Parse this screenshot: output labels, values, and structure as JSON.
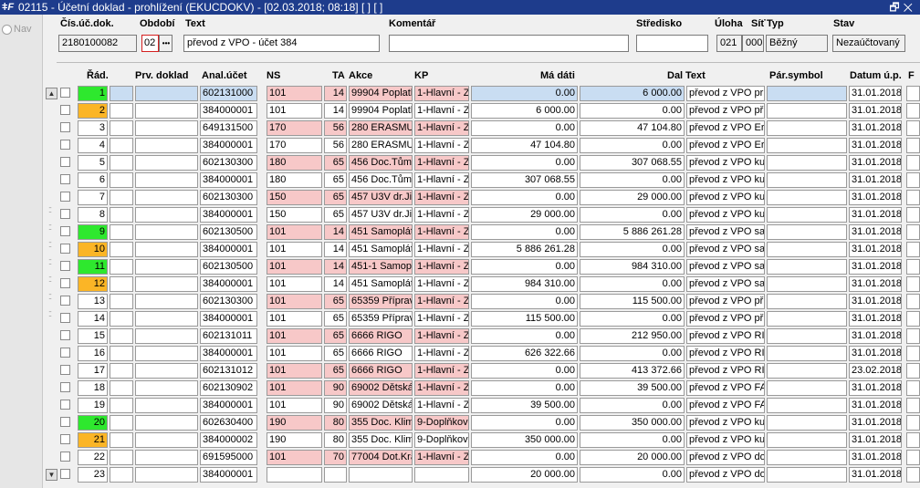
{
  "window": {
    "title": "02115 - Účetní doklad - prohlížení (EKUCDOKV) - [02.03.2018; 08:18]  [ ]  [ ]",
    "controls": "🗗✕"
  },
  "nav": {
    "label": "Nav"
  },
  "header": {
    "labels": {
      "doc_no": "Čís.úč.dok.",
      "period": "Období",
      "text": "Text",
      "comment": "Komentář",
      "center": "Středisko",
      "task": "Úloha",
      "network": "Síť",
      "type": "Typ",
      "state": "Stav"
    },
    "values": {
      "doc_no": "2180100082",
      "period": "02",
      "period_button": "•••",
      "text": "převod z VPO - účet 384",
      "comment": "",
      "center": "",
      "task": "021",
      "network": "000",
      "type": "Běžný",
      "state": "Nezaúčtovaný"
    }
  },
  "columns": {
    "row": "Řád.",
    "first_doc": "Prv. doklad",
    "account": "Anal.účet",
    "ns": "NS",
    "ta": "TA",
    "action": "Akce",
    "kp": "KP",
    "debit": "Má dáti",
    "credit": "Dal",
    "text": "Text",
    "pair": "Pár.symbol",
    "date": "Datum ú.p.",
    "extra": "F"
  },
  "colors": {
    "green": "#2ee82e",
    "orange": "#fbb526",
    "pink": "#f7c8c8",
    "highlight": "#c9ddf2",
    "titlebar": "#1e3c8c"
  },
  "rows": [
    {
      "n": "1",
      "color": "green",
      "first": "",
      "account": "602131000",
      "ns": "101",
      "ta": "14",
      "akce": "99904 Poplatky",
      "kp": "1-Hlavní - Zdaň",
      "debit": "0.00",
      "credit": "6 000.00",
      "text": "převod z VPO pr",
      "pair": "",
      "date": "31.01.2018",
      "pink": true,
      "hl": true
    },
    {
      "n": "2",
      "color": "orange",
      "first": "",
      "account": "384000001",
      "ns": "101",
      "ta": "14",
      "akce": "99904 Poplatky",
      "kp": "1-Hlavní - Zdaň",
      "debit": "6 000.00",
      "credit": "0.00",
      "text": "převod z VPO př.",
      "pair": "",
      "date": "31.01.2018",
      "pink": false,
      "hl": false
    },
    {
      "n": "3",
      "color": "",
      "first": "",
      "account": "649131500",
      "ns": "170",
      "ta": "56",
      "akce": "280 ERASMUS",
      "kp": "1-Hlavní - Zdaň",
      "debit": "0.00",
      "credit": "47 104.80",
      "text": "převod z VPO Era",
      "pair": "",
      "date": "31.01.2018",
      "pink": true,
      "hl": false
    },
    {
      "n": "4",
      "color": "",
      "first": "",
      "account": "384000001",
      "ns": "170",
      "ta": "56",
      "akce": "280 ERASMUS",
      "kp": "1-Hlavní - Zdaň",
      "debit": "47 104.80",
      "credit": "0.00",
      "text": "převod z VPO Era",
      "pair": "",
      "date": "31.01.2018",
      "pink": false,
      "hl": false
    },
    {
      "n": "5",
      "color": "",
      "first": "",
      "account": "602130300",
      "ns": "180",
      "ta": "65",
      "akce": "456 Doc.Tůma",
      "kp": "1-Hlavní - Zdaň",
      "debit": "0.00",
      "credit": "307 068.55",
      "text": "převod z VPO kur",
      "pair": "",
      "date": "31.01.2018",
      "pink": true,
      "hl": false
    },
    {
      "n": "6",
      "color": "",
      "first": "",
      "account": "384000001",
      "ns": "180",
      "ta": "65",
      "akce": "456 Doc.Tůma",
      "kp": "1-Hlavní - Zdaň",
      "debit": "307 068.55",
      "credit": "0.00",
      "text": "převod z VPO kur",
      "pair": "",
      "date": "31.01.2018",
      "pink": false,
      "hl": false
    },
    {
      "n": "7",
      "color": "",
      "first": "",
      "account": "602130300",
      "ns": "150",
      "ta": "65",
      "akce": "457 U3V dr.Jiř",
      "kp": "1-Hlavní - Zdaň",
      "debit": "0.00",
      "credit": "29 000.00",
      "text": "převod z VPO kur",
      "pair": "",
      "date": "31.01.2018",
      "pink": true,
      "hl": false
    },
    {
      "n": "8",
      "color": "",
      "first": "",
      "account": "384000001",
      "ns": "150",
      "ta": "65",
      "akce": "457 U3V dr.Jiř",
      "kp": "1-Hlavní - Zdaň",
      "debit": "29 000.00",
      "credit": "0.00",
      "text": "převod z VPO kur",
      "pair": "",
      "date": "31.01.2018",
      "pink": false,
      "hl": false
    },
    {
      "n": "9",
      "color": "green",
      "first": "",
      "account": "602130500",
      "ns": "101",
      "ta": "14",
      "akce": "451 Samoplátci",
      "kp": "1-Hlavní - Zdaň",
      "debit": "0.00",
      "credit": "5 886 261.28",
      "text": "převod z VPO sar",
      "pair": "",
      "date": "31.01.2018",
      "pink": true,
      "hl": false
    },
    {
      "n": "10",
      "color": "orange",
      "first": "",
      "account": "384000001",
      "ns": "101",
      "ta": "14",
      "akce": "451 Samoplátci",
      "kp": "1-Hlavní - Zdaň",
      "debit": "5 886 261.28",
      "credit": "0.00",
      "text": "převod z VPO sar",
      "pair": "",
      "date": "31.01.2018",
      "pink": false,
      "hl": false
    },
    {
      "n": "11",
      "color": "green",
      "first": "",
      "account": "602130500",
      "ns": "101",
      "ta": "14",
      "akce": "451-1 Samoplá",
      "kp": "1-Hlavní - Zdaň",
      "debit": "0.00",
      "credit": "984 310.00",
      "text": "převod z VPO sar",
      "pair": "",
      "date": "31.01.2018",
      "pink": true,
      "hl": false
    },
    {
      "n": "12",
      "color": "orange",
      "first": "",
      "account": "384000001",
      "ns": "101",
      "ta": "14",
      "akce": "451 Samoplátci",
      "kp": "1-Hlavní - Zdaň",
      "debit": "984 310.00",
      "credit": "0.00",
      "text": "převod z VPO sar",
      "pair": "",
      "date": "31.01.2018",
      "pink": false,
      "hl": false
    },
    {
      "n": "13",
      "color": "",
      "first": "",
      "account": "602130300",
      "ns": "101",
      "ta": "65",
      "akce": "65359 Příprava",
      "kp": "1-Hlavní - Zdaň",
      "debit": "0.00",
      "credit": "115 500.00",
      "text": "převod z VPO př.",
      "pair": "",
      "date": "31.01.2018",
      "pink": true,
      "hl": false
    },
    {
      "n": "14",
      "color": "",
      "first": "",
      "account": "384000001",
      "ns": "101",
      "ta": "65",
      "akce": "65359 Příprava",
      "kp": "1-Hlavní - Zdaň",
      "debit": "115 500.00",
      "credit": "0.00",
      "text": "převod z VPO př.",
      "pair": "",
      "date": "31.01.2018",
      "pink": false,
      "hl": false
    },
    {
      "n": "15",
      "color": "",
      "first": "",
      "account": "602131011",
      "ns": "101",
      "ta": "65",
      "akce": "6666 RIGO",
      "kp": "1-Hlavní - Zdaň",
      "debit": "0.00",
      "credit": "212 950.00",
      "text": "převod z VPO RIG",
      "pair": "",
      "date": "31.01.2018",
      "pink": true,
      "hl": false
    },
    {
      "n": "16",
      "color": "",
      "first": "",
      "account": "384000001",
      "ns": "101",
      "ta": "65",
      "akce": "6666 RIGO",
      "kp": "1-Hlavní - Zdaň",
      "debit": "626 322.66",
      "credit": "0.00",
      "text": "převod z VPO RIG",
      "pair": "",
      "date": "31.01.2018",
      "pink": false,
      "hl": false
    },
    {
      "n": "17",
      "color": "",
      "first": "",
      "account": "602131012",
      "ns": "101",
      "ta": "65",
      "akce": "6666 RIGO",
      "kp": "1-Hlavní - Zdaň",
      "debit": "0.00",
      "credit": "413 372.66",
      "text": "převod z VPO RIG",
      "pair": "",
      "date": "23.02.2018",
      "pink": true,
      "hl": false
    },
    {
      "n": "18",
      "color": "",
      "first": "",
      "account": "602130902",
      "ns": "101",
      "ta": "90",
      "akce": "69002 Dětská",
      "kp": "1-Hlavní - Zdaň",
      "debit": "0.00",
      "credit": "39 500.00",
      "text": "převod z VPO FA",
      "pair": "",
      "date": "31.01.2018",
      "pink": true,
      "hl": false
    },
    {
      "n": "19",
      "color": "",
      "first": "",
      "account": "384000001",
      "ns": "101",
      "ta": "90",
      "akce": "69002 Dětská",
      "kp": "1-Hlavní - Zdaň",
      "debit": "39 500.00",
      "credit": "0.00",
      "text": "převod z VPO FA",
      "pair": "",
      "date": "31.01.2018",
      "pink": false,
      "hl": false
    },
    {
      "n": "20",
      "color": "green",
      "first": "",
      "account": "602630400",
      "ns": "190",
      "ta": "80",
      "akce": "355 Doc. Klima",
      "kp": "9-Doplňková",
      "debit": "0.00",
      "credit": "350 000.00",
      "text": "převod z VPO kur",
      "pair": "",
      "date": "31.01.2018",
      "pink": true,
      "hl": false
    },
    {
      "n": "21",
      "color": "orange",
      "first": "",
      "account": "384000002",
      "ns": "190",
      "ta": "80",
      "akce": "355 Doc. Klima",
      "kp": "9-Doplňková",
      "debit": "350 000.00",
      "credit": "0.00",
      "text": "převod z VPO kur",
      "pair": "",
      "date": "31.01.2018",
      "pink": false,
      "hl": false
    },
    {
      "n": "22",
      "color": "",
      "first": "",
      "account": "691595000",
      "ns": "101",
      "ta": "70",
      "akce": "77004 Dot.Kraj",
      "kp": "1-Hlavní - Zdaň",
      "debit": "0.00",
      "credit": "20 000.00",
      "text": "převod z VPO dot",
      "pair": "",
      "date": "31.01.2018",
      "pink": true,
      "hl": false
    },
    {
      "n": "23",
      "color": "",
      "first": "",
      "account": "384000001",
      "ns": "",
      "ta": "",
      "akce": "",
      "kp": "",
      "debit": "20 000.00",
      "credit": "0.00",
      "text": "převod z VPO dot",
      "pair": "",
      "date": "31.01.2018",
      "pink": false,
      "hl": false
    }
  ]
}
